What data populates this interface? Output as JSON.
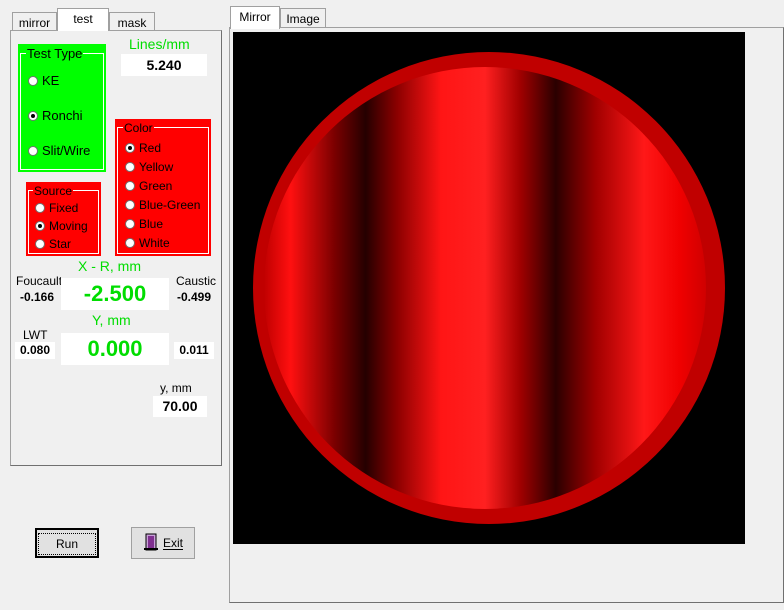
{
  "left_tabs": [
    "mirror",
    "test",
    "mask"
  ],
  "right_tabs": [
    "Mirror",
    "Image"
  ],
  "test_type": {
    "title": "Test Type",
    "options": [
      "KE",
      "Ronchi",
      "Slit/Wire"
    ],
    "selected": "Ronchi"
  },
  "lines_per_mm": {
    "label": "Lines/mm",
    "value": "5.240"
  },
  "color": {
    "title": "Color",
    "options": [
      "Red",
      "Yellow",
      "Green",
      "Blue-Green",
      "Blue",
      "White"
    ],
    "selected": "Red"
  },
  "source": {
    "title": "Source",
    "options": [
      "Fixed",
      "Moving",
      "Star"
    ],
    "selected": "Moving"
  },
  "xr": {
    "label": "X - R, mm",
    "value": "-2.500"
  },
  "y": {
    "label": "Y, mm",
    "value": "0.000"
  },
  "foucault": {
    "label": "Foucault",
    "value": "-0.166"
  },
  "caustic": {
    "label": "Caustic",
    "value": "-0.499"
  },
  "lwt": {
    "label": "LWT",
    "value": "0.080"
  },
  "right_small_value": "0.011",
  "y_small": {
    "label": "y, mm",
    "value": "70.00"
  },
  "buttons": {
    "run": "Run",
    "exit": "Exit"
  },
  "colors": {
    "panel_bg": "#f0f0f0",
    "green_group": "#00ff00",
    "red_group": "#ff0000",
    "green_text": "#00dd00",
    "ronchigram_bg": "#000000",
    "mirror_band": "#ff0000"
  }
}
